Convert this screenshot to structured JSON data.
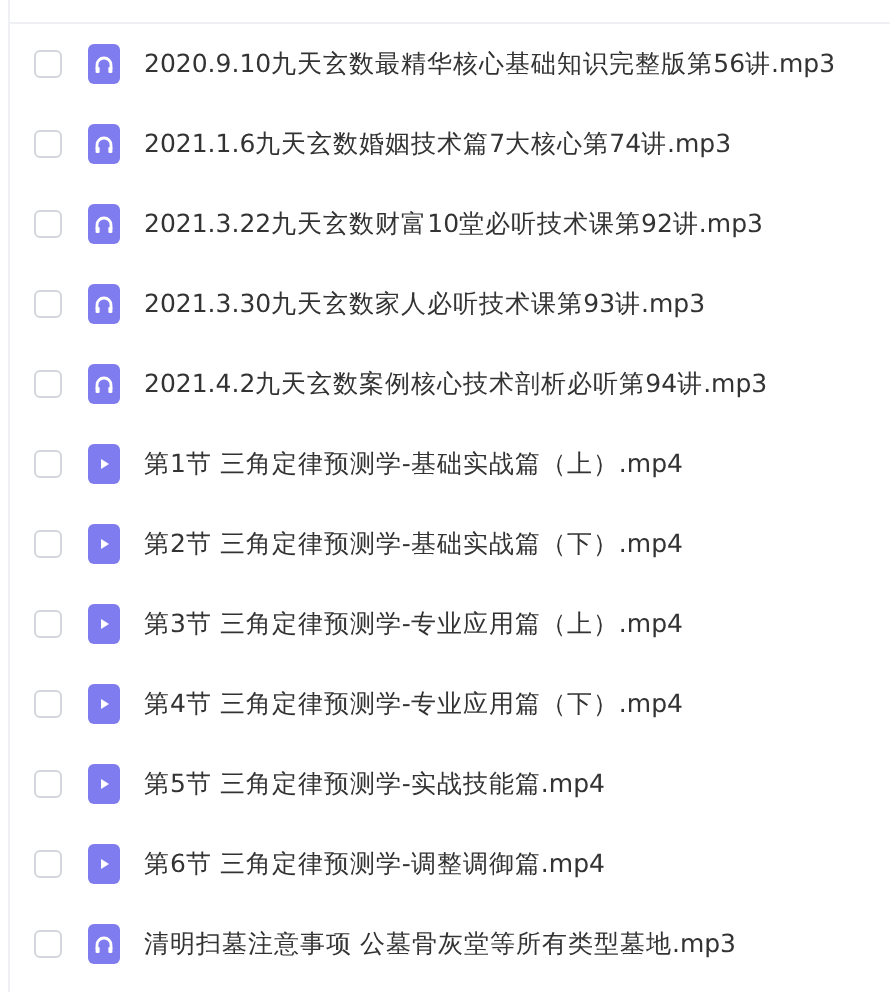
{
  "files": [
    {
      "kind": "audio",
      "name": "2020.9.10九天玄数最精华核心基础知识完整版第56讲.mp3",
      "checked": false
    },
    {
      "kind": "audio",
      "name": "2021.1.6九天玄数婚姻技术篇7大核心第74讲.mp3",
      "checked": false
    },
    {
      "kind": "audio",
      "name": "2021.3.22九天玄数财富10堂必听技术课第92讲.mp3",
      "checked": false
    },
    {
      "kind": "audio",
      "name": "2021.3.30九天玄数家人必听技术课第93讲.mp3",
      "checked": false
    },
    {
      "kind": "audio",
      "name": "2021.4.2九天玄数案例核心技术剖析必听第94讲.mp3",
      "checked": false
    },
    {
      "kind": "video",
      "name": "第1节 三角定律预测学-基础实战篇（上）.mp4",
      "checked": false
    },
    {
      "kind": "video",
      "name": "第2节 三角定律预测学-基础实战篇（下）.mp4",
      "checked": false
    },
    {
      "kind": "video",
      "name": "第3节 三角定律预测学-专业应用篇（上）.mp4",
      "checked": false
    },
    {
      "kind": "video",
      "name": "第4节 三角定律预测学-专业应用篇（下）.mp4",
      "checked": false
    },
    {
      "kind": "video",
      "name": "第5节 三角定律预测学-实战技能篇.mp4",
      "checked": false
    },
    {
      "kind": "video",
      "name": "第6节 三角定律预测学-调整调御篇.mp4",
      "checked": false
    },
    {
      "kind": "audio",
      "name": "清明扫墓注意事项 公墓骨灰堂等所有类型墓地.mp3",
      "checked": false
    }
  ]
}
